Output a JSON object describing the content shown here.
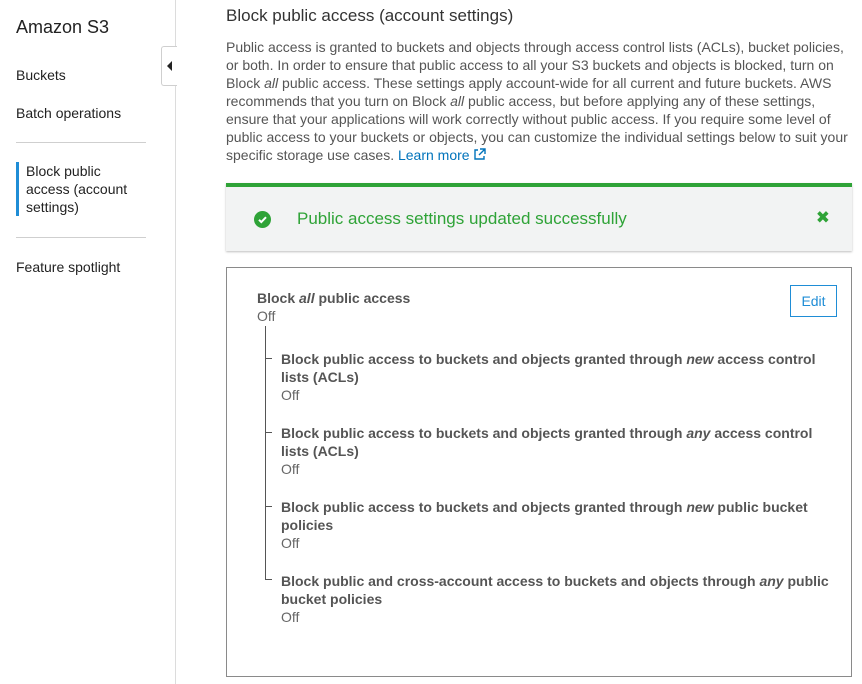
{
  "sidebar": {
    "brand": "Amazon S3",
    "items": [
      {
        "label": "Buckets"
      },
      {
        "label": "Batch operations"
      },
      {
        "label": "Block public access (account settings)"
      },
      {
        "label": "Feature spotlight"
      }
    ]
  },
  "main": {
    "title": "Block public access (account settings)",
    "intro": {
      "p1": "Public access is granted to buckets and objects through access control lists (ACLs), bucket policies, or both. In order to ensure that public access to all your S3 buckets and objects is blocked, turn on Block ",
      "em1": "all",
      "p2": " public access. These settings apply account-wide for all current and future buckets. AWS recommends that you turn on Block ",
      "em2": "all",
      "p3": " public access, but before applying any of these settings, ensure that your applications will work correctly without public access. If you require some level of public access to your buckets or objects, you can customize the individual settings below to suit your specific storage use cases. ",
      "learn_more": "Learn more"
    },
    "alert": {
      "message": "Public access settings updated successfully",
      "close_symbol": "✖"
    },
    "panel": {
      "edit_label": "Edit",
      "main_setting": {
        "pre": "Block ",
        "em": "all",
        "post": " public access",
        "value": "Off"
      },
      "settings": [
        {
          "pre": "Block public access to buckets and objects granted through ",
          "em": "new",
          "post": " access control lists (ACLs)",
          "value": "Off"
        },
        {
          "pre": "Block public access to buckets and objects granted through ",
          "em": "any",
          "post": " access control lists (ACLs)",
          "value": "Off"
        },
        {
          "pre": "Block public access to buckets and objects granted through ",
          "em": "new",
          "post": " public bucket policies",
          "value": "Off"
        },
        {
          "pre": "Block public and cross-account access to buckets and objects through ",
          "em": "any",
          "post": " public bucket policies",
          "value": "Off"
        }
      ]
    }
  },
  "colors": {
    "accent": "#1f8dd6",
    "success": "#2fa337",
    "link": "#0073bb"
  }
}
